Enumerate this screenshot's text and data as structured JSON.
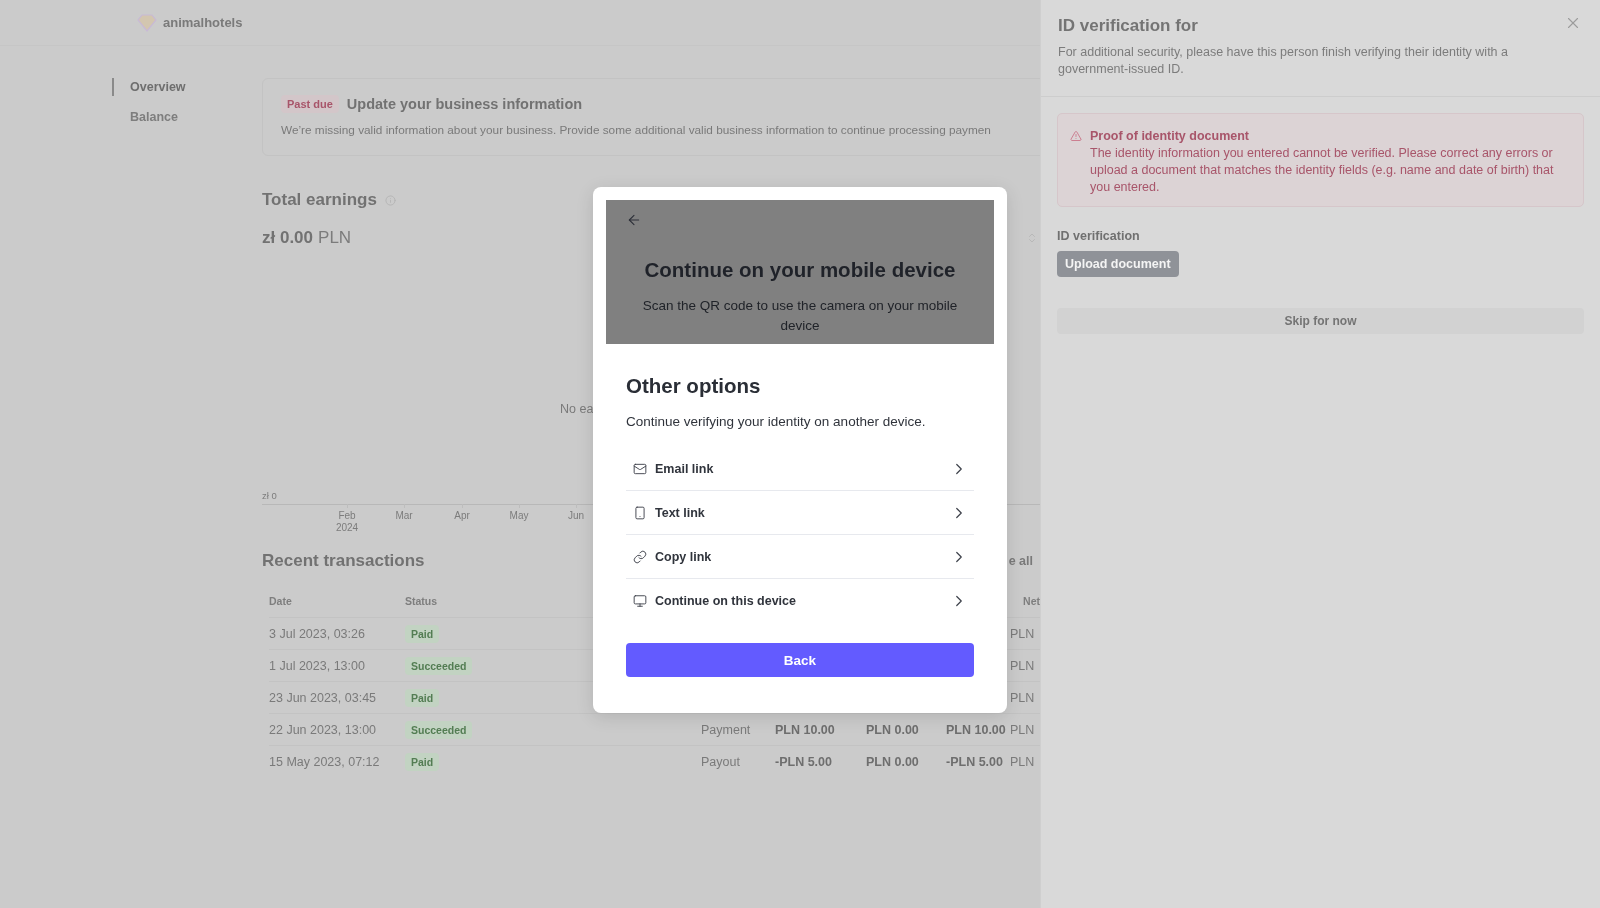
{
  "brand": {
    "name": "animalhotels"
  },
  "sidebar": {
    "items": [
      {
        "label": "Overview",
        "selected": true
      },
      {
        "label": "Balance",
        "selected": false
      }
    ]
  },
  "banner": {
    "badge": "Past due",
    "title": "Update your business information",
    "text": "We’re missing valid information about your business. Provide some additional valid business information to continue processing paymen"
  },
  "earnings": {
    "title": "Total earnings",
    "amount": "zł 0.00",
    "currency": "PLN",
    "empty_message": "No ea",
    "y_label": "zł 0",
    "x_labels": [
      {
        "label": "Feb",
        "sub": "2024"
      },
      {
        "label": "Mar"
      },
      {
        "label": "Apr"
      },
      {
        "label": "May"
      },
      {
        "label": "Jun"
      }
    ]
  },
  "transactions": {
    "title": "Recent transactions",
    "link": "e all",
    "columns": [
      {
        "label": "Date"
      },
      {
        "label": "Status"
      },
      {
        "label": "Net"
      }
    ],
    "rows": [
      {
        "date": "3 Jul 2023, 03:26",
        "status": "Paid",
        "column_7": "PLN"
      },
      {
        "date": "1 Jul 2023, 13:00",
        "status": "Succeeded",
        "column_7": "PLN"
      },
      {
        "date": "23 Jun 2023, 03:45",
        "status": "Paid",
        "column_7": "PLN"
      },
      {
        "date": "22 Jun 2023, 13:00",
        "status": "Succeeded",
        "type": "Payment",
        "amount": "PLN 10.00",
        "fee": "PLN 0.00",
        "net": "PLN 10.00",
        "column_7": "PLN"
      },
      {
        "date": "15 May 2023, 07:12",
        "status": "Paid",
        "type": "Payout",
        "amount": "-PLN 5.00",
        "fee": "PLN 0.00",
        "net": "-PLN 5.00",
        "column_7": "PLN"
      }
    ]
  },
  "side_panel": {
    "title": "ID verification for",
    "description": "For additional security, please have this person finish verifying their identity with a government-issued ID.",
    "alert": {
      "title": "Proof of identity document",
      "text": "The identity information you entered cannot be verified. Please correct any errors or upload a document that matches the identity fields (e.g. name and date of birth) that you entered."
    },
    "section_label": "ID verification",
    "upload_button": "Upload document",
    "skip_button": "Skip for now"
  },
  "modal": {
    "title": "Continue on your mobile device",
    "subtitle": "Scan the QR code to use the camera on your mobile device",
    "sheet": {
      "title": "Other options",
      "description": "Continue verifying your identity on another device.",
      "options": [
        {
          "kind": "email",
          "label": "Email link"
        },
        {
          "kind": "sms",
          "label": "Text link"
        },
        {
          "kind": "copy",
          "label": "Copy link"
        },
        {
          "kind": "device",
          "label": "Continue on this device"
        }
      ],
      "button": "Back"
    }
  }
}
